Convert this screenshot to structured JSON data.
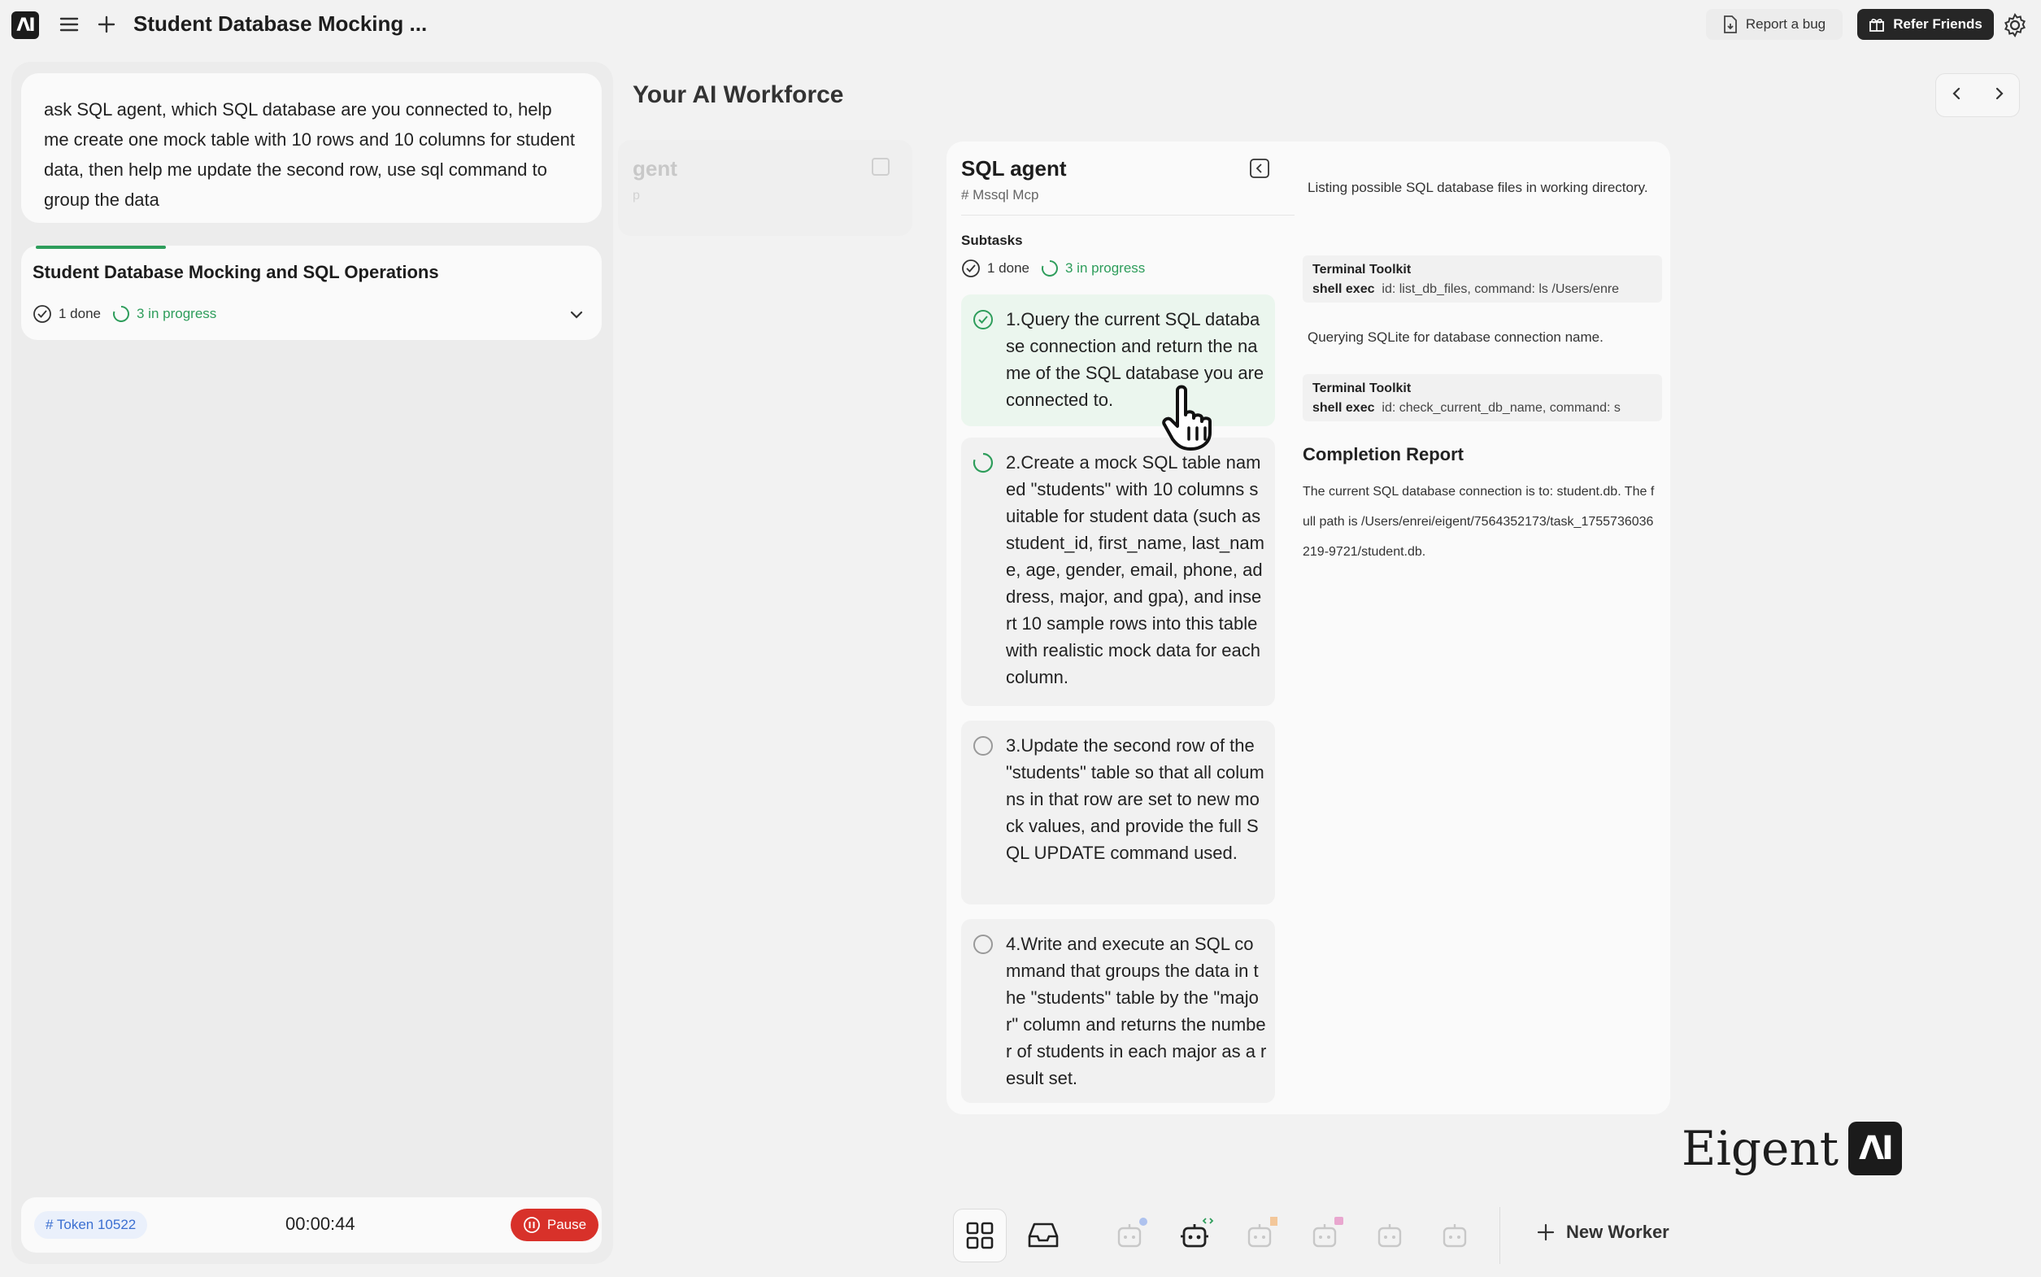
{
  "header": {
    "logo_text": "ΛI",
    "title": "Student Database Mocking ...",
    "report_bug_label": "Report a bug",
    "refer_friends_label": "Refer Friends"
  },
  "chat": {
    "prompt": "ask SQL agent, which SQL database are you connected to, help me create one mock table with 10 rows and 10 columns for student data, then help me update the second row, use sql command to group the  data",
    "task": {
      "title": "Student Database Mocking and SQL Operations",
      "done_label": "1 done",
      "progress_label": "3 in progress"
    },
    "footer": {
      "token_label": "# Token 10522",
      "timer": "00:00:44",
      "pause_label": "Pause"
    }
  },
  "workforce": {
    "title": "Your AI Workforce",
    "ghost_agent": {
      "title": "gent",
      "tag": "p"
    },
    "agent": {
      "title": "SQL agent",
      "tag": "# Mssql Mcp",
      "subtasks_label": "Subtasks",
      "done_label": "1 done",
      "progress_label": "3 in progress",
      "subtasks": [
        {
          "text": "1.Query the current SQL database connection and return the name of the SQL database you are connected to.",
          "status": "done"
        },
        {
          "text": "2.Create a mock SQL table named \"students\" with 10 columns suitable for student data (such as student_id, first_name, last_name, age, gender, email, phone, address, major, and gpa), and insert 10 sample rows into this table with realistic mock data for each column.",
          "status": "in-progress"
        },
        {
          "text": "3.Update the second row of the \"students\" table so that all columns in that row are set to new mock values, and provide the full SQL UPDATE command used.",
          "status": "pending"
        },
        {
          "text": "4.Write and execute an SQL command that groups the data in the \"students\" table by the \"major\" column and returns the number of students in each major as a result set.",
          "status": "pending"
        }
      ],
      "log": {
        "line1": "Listing possible SQL database files in working directory.",
        "toolkit1": {
          "name": "Terminal Toolkit",
          "method": "shell exec",
          "args": "id: list_db_files, command: ls /Users/enre"
        },
        "line2": "Querying SQLite for database connection name.",
        "toolkit2": {
          "name": "Terminal Toolkit",
          "method": "shell exec",
          "args": "id: check_current_db_name, command: s"
        },
        "completion_title": "Completion Report",
        "completion_body": "The current SQL database connection is to: student.db. The full path is /Users/enrei/eigent/7564352173/task_1755736036219-9721/student.db."
      }
    }
  },
  "brand": {
    "text": "Eigent",
    "logo_text": "ΛI"
  },
  "dock": {
    "new_worker_label": "New Worker"
  },
  "colors": {
    "accent_green": "#2e9d5b",
    "pause_red": "#d8312a",
    "token_blue": "#3b6fd1"
  }
}
